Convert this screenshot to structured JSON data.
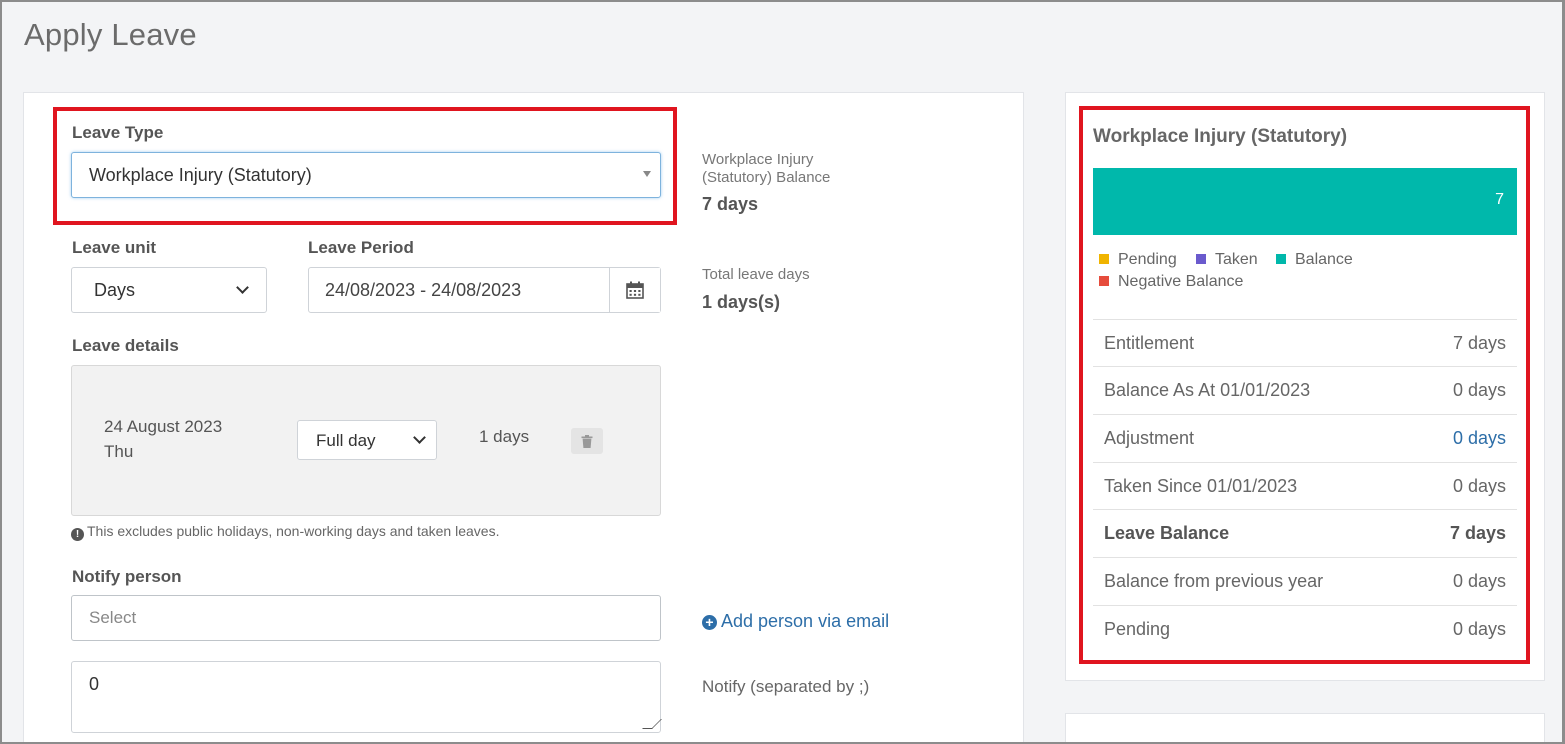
{
  "page": {
    "title": "Apply Leave"
  },
  "form": {
    "leave_type_label": "Leave Type",
    "leave_type_value": "Workplace Injury (Statutory)",
    "balance_label": "Workplace Injury (Statutory) Balance",
    "balance_label_line1": "Workplace Injury",
    "balance_label_line2": "(Statutory) Balance",
    "balance_value": "7 days",
    "leave_unit_label": "Leave unit",
    "leave_unit_value": "Days",
    "leave_period_label": "Leave Period",
    "leave_period_value": "24/08/2023 - 24/08/2023",
    "total_days_label": "Total leave days",
    "total_days_value": "1 days(s)",
    "leave_details_label": "Leave details",
    "detail": {
      "date": "24 August 2023",
      "weekday": "Thu",
      "duration": "Full day",
      "days": "1 days"
    },
    "note": "This excludes public holidays, non-working days and taken leaves.",
    "notify_label": "Notify person",
    "notify_placeholder": "Select",
    "add_person_link": "Add person via email",
    "notify_email_value": "0",
    "notify_separator_label": "Notify (separated by ;)"
  },
  "summary": {
    "title": "Workplace Injury (Statutory)",
    "bar_value": "7",
    "legend": [
      {
        "label": "Pending",
        "color": "#f0b400"
      },
      {
        "label": "Taken",
        "color": "#6a5acd"
      },
      {
        "label": "Balance",
        "color": "#00b8ab"
      },
      {
        "label": "Negative Balance",
        "color": "#e64c3c"
      }
    ],
    "rows": [
      {
        "key": "Entitlement",
        "value": "7 days"
      },
      {
        "key": "Balance As At 01/01/2023",
        "value": "0 days"
      },
      {
        "key": "Adjustment",
        "value": "0 days"
      },
      {
        "key": "Taken Since 01/01/2023",
        "value": "0 days"
      },
      {
        "key": "Leave Balance",
        "value": "7 days"
      },
      {
        "key": "Balance from previous year",
        "value": "0 days"
      },
      {
        "key": "Pending",
        "value": "0 days"
      }
    ]
  },
  "colors": {
    "accent": "#00b8ab",
    "highlight_border": "#e0151f",
    "link": "#2d6ea8"
  }
}
